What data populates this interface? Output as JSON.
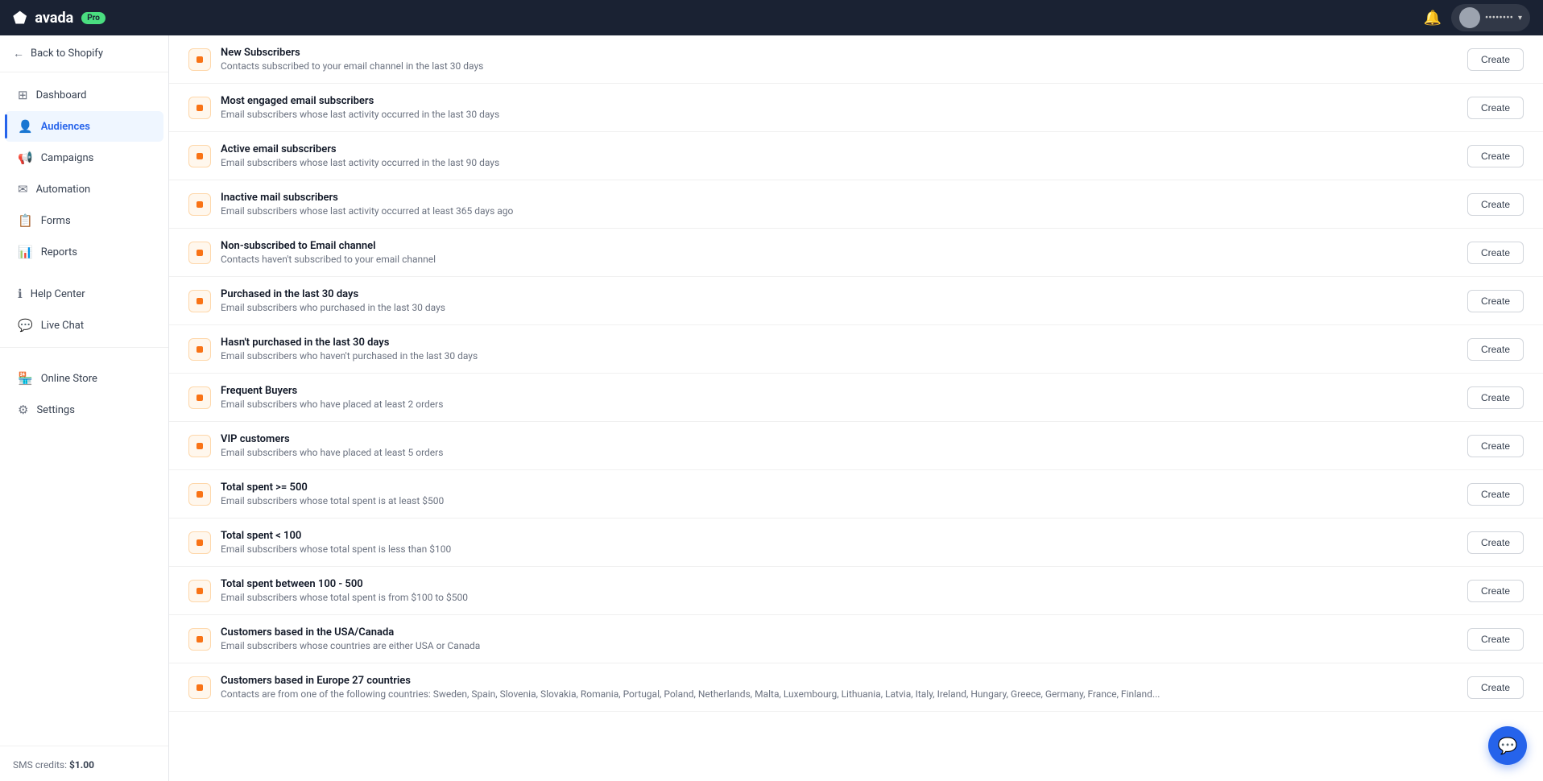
{
  "topNav": {
    "logoText": "avada",
    "proBadge": "Pro",
    "bellIcon": "🔔",
    "userDropdownIcon": "▾"
  },
  "sidebar": {
    "backLabel": "Back to Shopify",
    "items": [
      {
        "id": "dashboard",
        "label": "Dashboard",
        "icon": "⊞",
        "active": false
      },
      {
        "id": "audiences",
        "label": "Audiences",
        "icon": "👤",
        "active": true
      },
      {
        "id": "campaigns",
        "label": "Campaigns",
        "icon": "📢",
        "active": false
      },
      {
        "id": "automation",
        "label": "Automation",
        "icon": "✉",
        "active": false
      },
      {
        "id": "forms",
        "label": "Forms",
        "icon": "📋",
        "active": false
      },
      {
        "id": "reports",
        "label": "Reports",
        "icon": "📊",
        "active": false
      }
    ],
    "supportItems": [
      {
        "id": "help-center",
        "label": "Help Center",
        "icon": "ℹ"
      },
      {
        "id": "live-chat",
        "label": "Live Chat",
        "icon": "💬"
      }
    ],
    "bottomItems": [
      {
        "id": "online-store",
        "label": "Online Store",
        "icon": "🏪",
        "active": false
      },
      {
        "id": "settings",
        "label": "Settings",
        "icon": "⚙",
        "active": false
      }
    ],
    "smsCreditsLabel": "SMS credits:",
    "smsCreditsValue": "$1.00"
  },
  "audienceList": {
    "rows": [
      {
        "id": "new-subscribers",
        "title": "New Subscribers",
        "desc": "Contacts subscribed to your email channel in the last 30 days",
        "buttonLabel": "Create"
      },
      {
        "id": "most-engaged",
        "title": "Most engaged email subscribers",
        "desc": "Email subscribers whose last activity occurred in the last 30 days",
        "buttonLabel": "Create"
      },
      {
        "id": "active-subscribers",
        "title": "Active email subscribers",
        "desc": "Email subscribers whose last activity occurred in the last 90 days",
        "buttonLabel": "Create"
      },
      {
        "id": "inactive-subscribers",
        "title": "Inactive mail subscribers",
        "desc": "Email subscribers whose last activity occurred at least 365 days ago",
        "buttonLabel": "Create"
      },
      {
        "id": "non-subscribed",
        "title": "Non-subscribed to Email channel",
        "desc": "Contacts haven't subscribed to your email channel",
        "buttonLabel": "Create"
      },
      {
        "id": "purchased-30",
        "title": "Purchased in the last 30 days",
        "desc": "Email subscribers who purchased in the last 30 days",
        "buttonLabel": "Create"
      },
      {
        "id": "not-purchased-30",
        "title": "Hasn't purchased in the last 30 days",
        "desc": "Email subscribers who haven't purchased in the last 30 days",
        "buttonLabel": "Create"
      },
      {
        "id": "frequent-buyers",
        "title": "Frequent Buyers",
        "desc": "Email subscribers who have placed at least 2 orders",
        "buttonLabel": "Create"
      },
      {
        "id": "vip-customers",
        "title": "VIP customers",
        "desc": "Email subscribers who have placed at least 5 orders",
        "buttonLabel": "Create"
      },
      {
        "id": "total-spent-gte-500",
        "title": "Total spent >= 500",
        "desc": "Email subscribers whose total spent is at least $500",
        "buttonLabel": "Create"
      },
      {
        "id": "total-spent-lt-100",
        "title": "Total spent < 100",
        "desc": "Email subscribers whose total spent is less than $100",
        "buttonLabel": "Create"
      },
      {
        "id": "total-spent-100-500",
        "title": "Total spent between 100 - 500",
        "desc": "Email subscribers whose total spent is from $100 to $500",
        "buttonLabel": "Create"
      },
      {
        "id": "usa-canada",
        "title": "Customers based in the USA/Canada",
        "desc": "Email subscribers whose countries are either USA or Canada",
        "buttonLabel": "Create"
      },
      {
        "id": "europe-27",
        "title": "Customers based in Europe 27 countries",
        "desc": "Contacts are from one of the following countries: Sweden, Spain, Slovenia, Slovakia, Romania, Portugal, Poland, Netherlands, Malta, Luxembourg, Lithuania, Latvia, Italy, Ireland, Hungary, Greece, Germany, France, Finland...",
        "buttonLabel": "Create"
      }
    ]
  },
  "chatBubble": {
    "icon": "💬"
  }
}
